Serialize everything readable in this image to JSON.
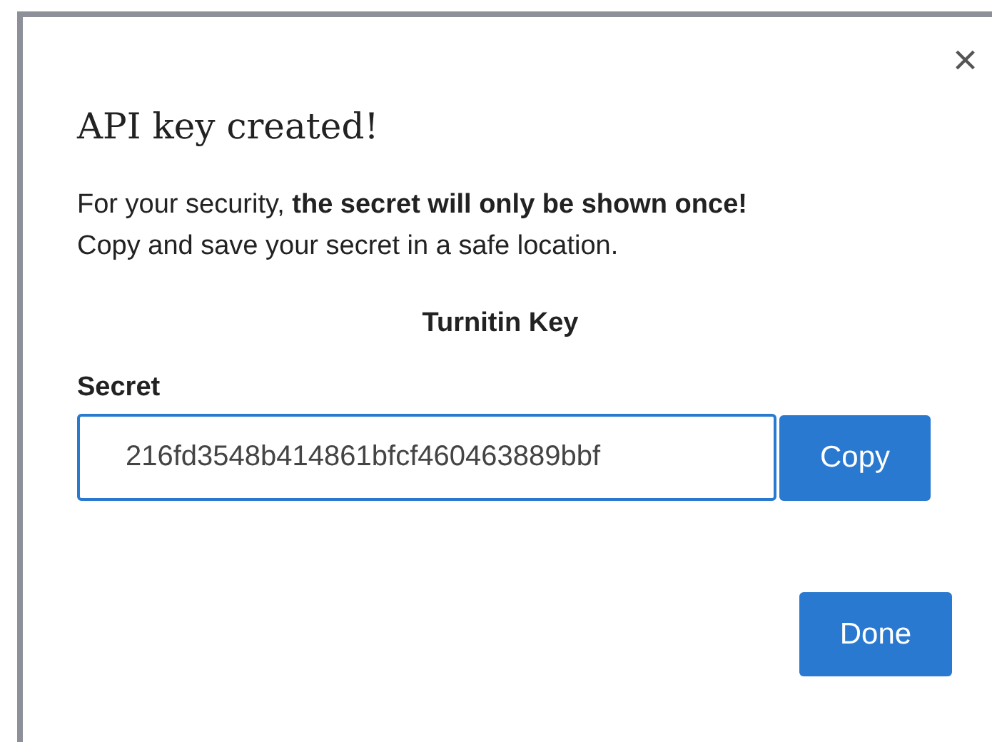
{
  "dialog": {
    "close": "×",
    "title": "API key created!",
    "message": "For your security, **the secret will only be shown once!**\nCopy and save your secret in a safe location.",
    "key_name": "Turnitin Key",
    "secret": {
      "label": "Secret",
      "value": "216fd3548b414861bfcf460463889bbf",
      "focused": true
    },
    "buttons": [
      {
        "label": "Copy",
        "kind": "inline"
      },
      {
        "label": "Done",
        "kind": "footer"
      }
    ]
  }
}
